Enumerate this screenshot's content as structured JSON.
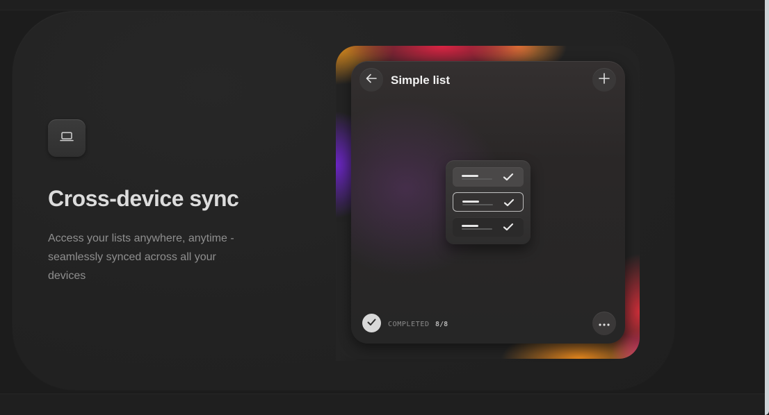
{
  "feature": {
    "icon": "laptop-icon",
    "title": "Cross-device sync",
    "description": "Access your lists anywhere, anytime - seamlessly synced across all your devices"
  },
  "preview": {
    "title": "Simple list",
    "back_icon": "arrow-left-icon",
    "add_icon": "plus-icon",
    "more_icon": "more-horizontal-icon",
    "list_rows": [
      {
        "state": "highlighted",
        "check_icon": "check-icon"
      },
      {
        "state": "selected",
        "check_icon": "check-icon"
      },
      {
        "state": "normal",
        "check_icon": "check-icon"
      }
    ],
    "completed": {
      "label": "COMPLETED",
      "count": "8/8"
    }
  },
  "colors": {
    "background": "#1c1c1c",
    "card": "#222222",
    "title": "#dcdcdc",
    "description": "#8f8f8f",
    "accent_red": "#d72846",
    "accent_orange": "#e68c28",
    "accent_purple": "#6e28c8"
  }
}
